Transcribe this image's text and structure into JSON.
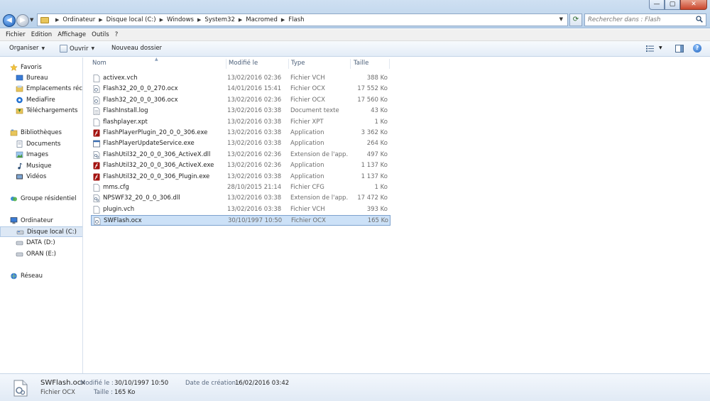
{
  "window": {
    "controls": {
      "minimize": "—",
      "maximize": "▢",
      "close": "✕"
    }
  },
  "address": {
    "crumbs": [
      "Ordinateur",
      "Disque local (C:)",
      "Windows",
      "System32",
      "Macromed",
      "Flash"
    ]
  },
  "search": {
    "placeholder": "Rechercher dans : Flash"
  },
  "menu": [
    "Fichier",
    "Edition",
    "Affichage",
    "Outils",
    "?"
  ],
  "toolbar": {
    "organize": "Organiser",
    "open": "Ouvrir",
    "new_folder": "Nouveau dossier"
  },
  "sidebar": {
    "favorites": "Favoris",
    "favorites_items": [
      "Bureau",
      "Emplacements récents",
      "MediaFire",
      "Téléchargements"
    ],
    "libraries": "Bibliothèques",
    "libraries_items": [
      "Documents",
      "Images",
      "Musique",
      "Vidéos"
    ],
    "homegroup": "Groupe résidentiel",
    "computer": "Ordinateur",
    "computer_items": [
      "Disque local (C:)",
      "DATA (D:)",
      "ORAN (E:)"
    ],
    "network": "Réseau"
  },
  "columns": {
    "name": "Nom",
    "modified": "Modifié le",
    "type": "Type",
    "size": "Taille"
  },
  "files": [
    {
      "name": "activex.vch",
      "date": "13/02/2016 02:36",
      "type": "Fichier VCH",
      "size": "388 Ko",
      "icon": "doc-icon"
    },
    {
      "name": "Flash32_20_0_0_270.ocx",
      "date": "14/01/2016 15:41",
      "type": "Fichier OCX",
      "size": "17 552 Ko",
      "icon": "ocx-icon"
    },
    {
      "name": "Flash32_20_0_0_306.ocx",
      "date": "13/02/2016 02:36",
      "type": "Fichier OCX",
      "size": "17 560 Ko",
      "icon": "ocx-icon"
    },
    {
      "name": "FlashInstall.log",
      "date": "13/02/2016 03:38",
      "type": "Document texte",
      "size": "43 Ko",
      "icon": "text-icon"
    },
    {
      "name": "flashplayer.xpt",
      "date": "13/02/2016 03:38",
      "type": "Fichier XPT",
      "size": "1 Ko",
      "icon": "doc-icon"
    },
    {
      "name": "FlashPlayerPlugin_20_0_0_306.exe",
      "date": "13/02/2016 03:38",
      "type": "Application",
      "size": "3 362 Ko",
      "icon": "flash-icon"
    },
    {
      "name": "FlashPlayerUpdateService.exe",
      "date": "13/02/2016 03:38",
      "type": "Application",
      "size": "264 Ko",
      "icon": "app-icon"
    },
    {
      "name": "FlashUtil32_20_0_0_306_ActiveX.dll",
      "date": "13/02/2016 02:36",
      "type": "Extension de l'app...",
      "size": "497 Ko",
      "icon": "dll-icon"
    },
    {
      "name": "FlashUtil32_20_0_0_306_ActiveX.exe",
      "date": "13/02/2016 02:36",
      "type": "Application",
      "size": "1 137 Ko",
      "icon": "flash-icon"
    },
    {
      "name": "FlashUtil32_20_0_0_306_Plugin.exe",
      "date": "13/02/2016 03:38",
      "type": "Application",
      "size": "1 137 Ko",
      "icon": "flash-icon"
    },
    {
      "name": "mms.cfg",
      "date": "28/10/2015 21:14",
      "type": "Fichier CFG",
      "size": "1 Ko",
      "icon": "doc-icon"
    },
    {
      "name": "NPSWF32_20_0_0_306.dll",
      "date": "13/02/2016 03:38",
      "type": "Extension de l'app...",
      "size": "17 472 Ko",
      "icon": "dll-icon"
    },
    {
      "name": "plugin.vch",
      "date": "13/02/2016 03:38",
      "type": "Fichier VCH",
      "size": "393 Ko",
      "icon": "doc-icon"
    },
    {
      "name": "SWFlash.ocx",
      "date": "30/10/1997 10:50",
      "type": "Fichier OCX",
      "size": "165 Ko",
      "icon": "ocx-icon"
    }
  ],
  "details": {
    "filename": "SWFlash.ocx",
    "filetype": "Fichier OCX",
    "modified_label": "Modifié le :",
    "modified_value": "30/10/1997 10:50",
    "size_label": "Taille :",
    "size_value": "165 Ko",
    "created_label": "Date de création :",
    "created_value": "16/02/2016 03:42"
  },
  "colors": {
    "selection": "#cce1f7",
    "selection_border": "#7da2ce",
    "header_text": "#4c607a"
  }
}
